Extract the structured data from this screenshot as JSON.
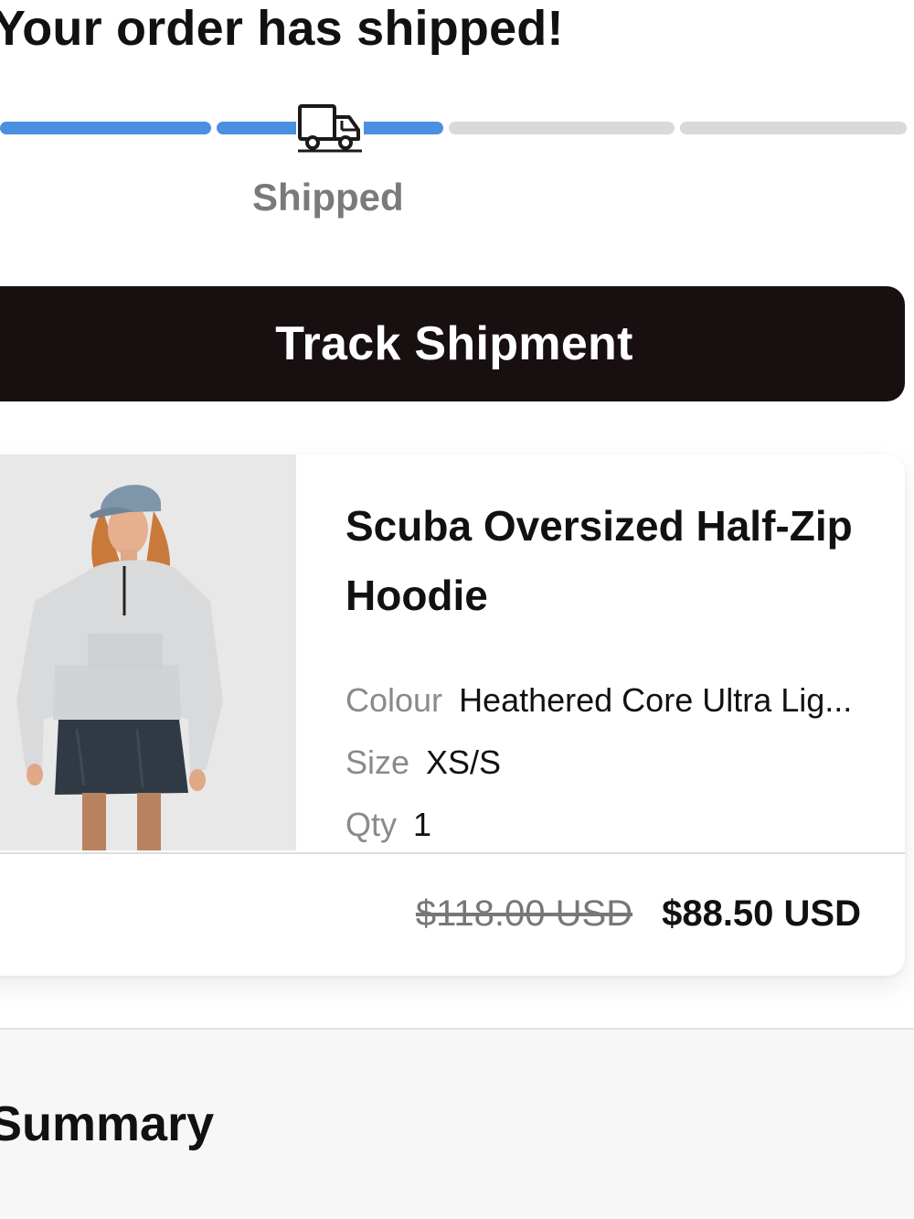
{
  "heading": "Your order has shipped!",
  "progress": {
    "stages_total": 4,
    "current_stage_label": "Shipped",
    "fill_fraction": 0.49,
    "active_color": "#4a8fe0",
    "inactive_color": "#d9d9d9",
    "icon": "truck-icon"
  },
  "track_button": {
    "label": "Track Shipment"
  },
  "product": {
    "name": "Scuba Oversized Half-Zip Hoodie",
    "image_alt": "product-photo",
    "colour_label": "Colour",
    "colour_value": "Heathered Core Ultra Lig...",
    "size_label": "Size",
    "size_value": "XS/S",
    "qty_label": "Qty",
    "qty_value": "1",
    "original_price": "$118.00 USD",
    "sale_price": "$88.50 USD"
  },
  "summary": {
    "title": "Summary"
  }
}
